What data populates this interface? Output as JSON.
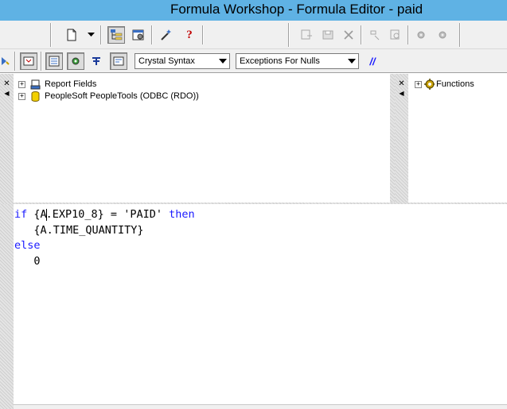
{
  "window": {
    "title": "Formula Workshop - Formula Editor - paid"
  },
  "toolbar": {
    "syntax": {
      "selected": "Crystal Syntax"
    },
    "null_handling": {
      "selected": "Exceptions For Nulls"
    },
    "comment_glyph": "//",
    "help_glyph": "?"
  },
  "field_tree": {
    "items": [
      {
        "label": "Report Fields",
        "expander": "+",
        "icon": "report-fields-icon"
      },
      {
        "label": "PeopleSoft PeopleTools (ODBC (RDO))",
        "expander": "+",
        "icon": "database-icon"
      }
    ]
  },
  "function_tree": {
    "items": [
      {
        "label": "Functions",
        "expander": "+",
        "icon": "functions-gear-icon"
      }
    ]
  },
  "editor": {
    "line1_kw_if": "if",
    "line1_a": " {A",
    "line1_b": ".EXP10_8} = 'PAID' ",
    "line1_kw_then": "then",
    "line2": "   {A.TIME_QUANTITY}",
    "line3_kw_else": "else",
    "line4": "   0"
  }
}
